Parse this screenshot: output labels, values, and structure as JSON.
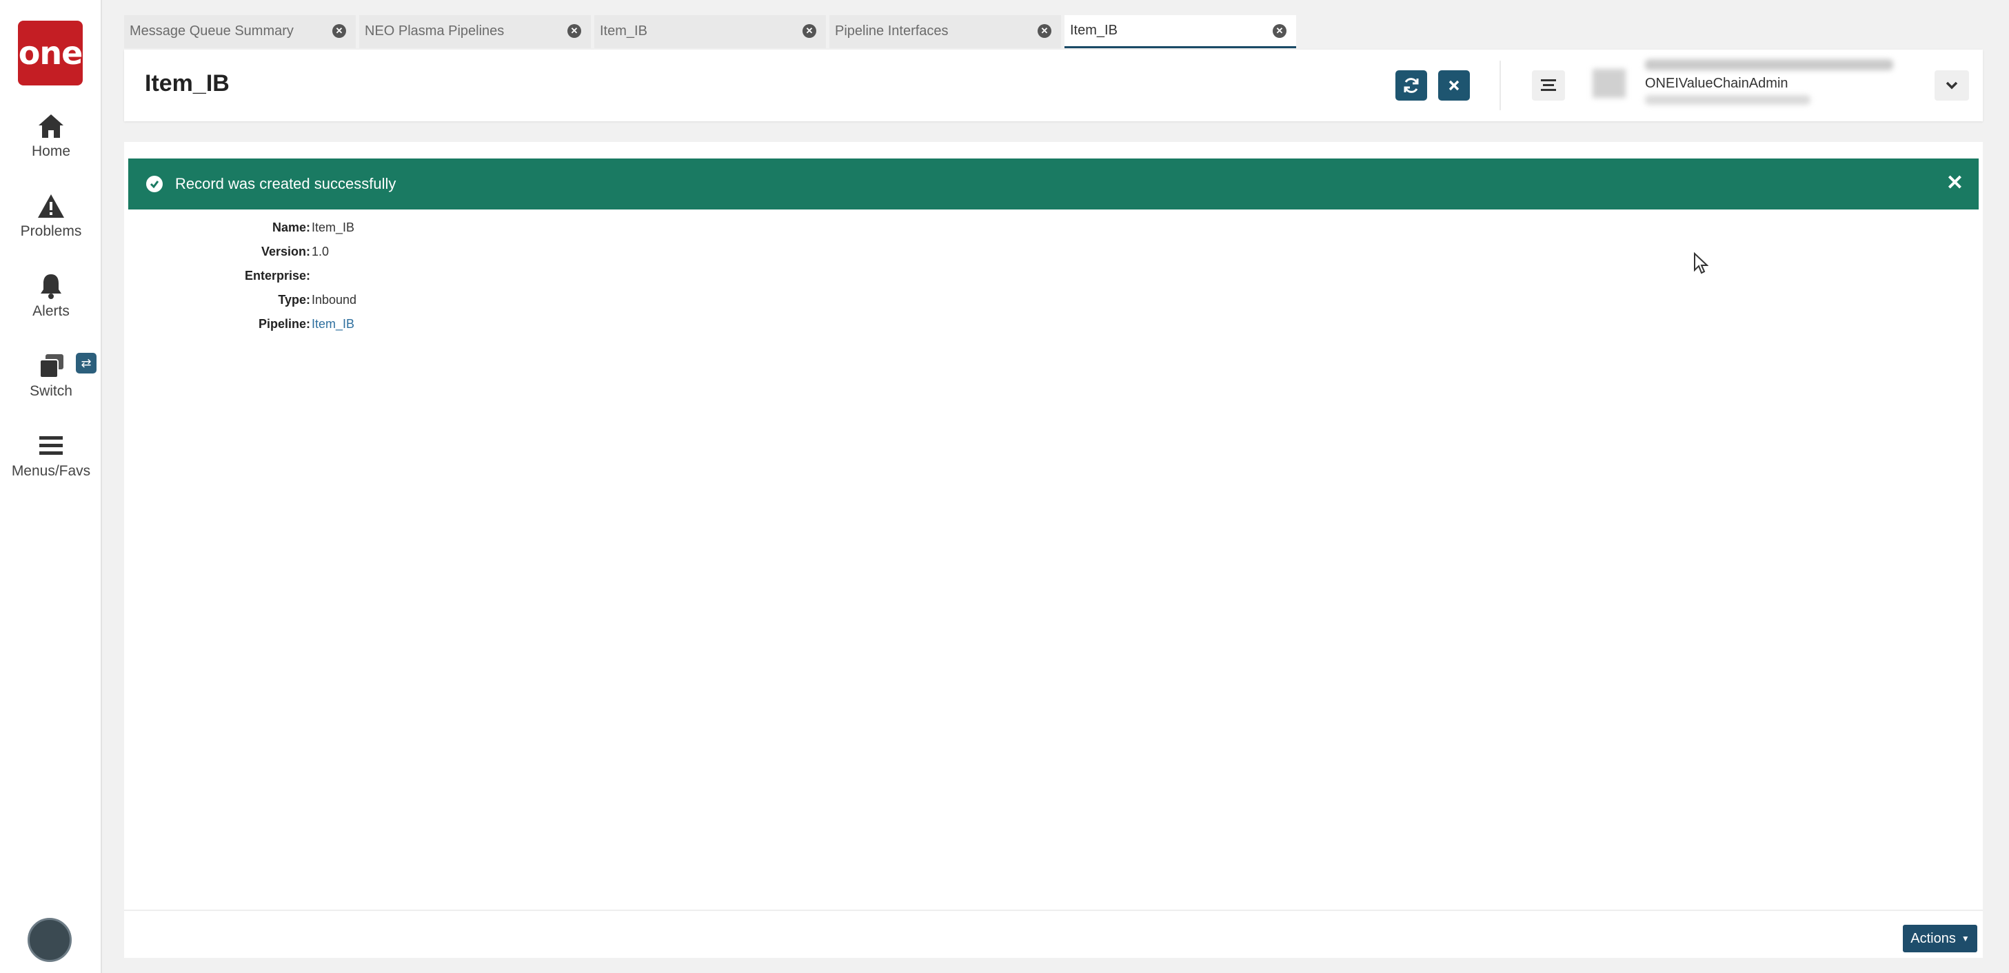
{
  "sidebar": {
    "logo_text": "one",
    "items": [
      {
        "label": "Home",
        "icon": "home-icon"
      },
      {
        "label": "Problems",
        "icon": "warning-icon"
      },
      {
        "label": "Alerts",
        "icon": "bell-icon"
      },
      {
        "label": "Switch",
        "icon": "switch-icon"
      },
      {
        "label": "Menus/Favs",
        "icon": "menu-icon"
      }
    ],
    "switch_badge_icon": "swap-icon"
  },
  "tabs": [
    {
      "label": "Message Queue Summary",
      "active": false
    },
    {
      "label": "NEO Plasma Pipelines",
      "active": false
    },
    {
      "label": "Item_IB",
      "active": false
    },
    {
      "label": "Pipeline Interfaces",
      "active": false
    },
    {
      "label": "Item_IB",
      "active": true
    }
  ],
  "header": {
    "title": "Item_IB",
    "refresh_icon": "refresh-icon",
    "close_icon": "close-icon",
    "menu_icon": "hamburger-icon",
    "user_role": "ONEIValueChainAdmin",
    "dropdown_icon": "chevron-down-icon"
  },
  "alert": {
    "message": "Record was created successfully",
    "color": "#1a7a62"
  },
  "fields": [
    {
      "label": "Name:",
      "value": "Item_IB"
    },
    {
      "label": "Version:",
      "value": "1.0"
    },
    {
      "label": "Enterprise:",
      "value": ""
    },
    {
      "label": "Type:",
      "value": "Inbound"
    },
    {
      "label": "Pipeline:",
      "value": "Item_IB"
    }
  ],
  "footer": {
    "actions_label": "Actions"
  },
  "colors": {
    "brand": "#c41e24",
    "primary": "#1e5570",
    "link": "#2e6f9e"
  }
}
